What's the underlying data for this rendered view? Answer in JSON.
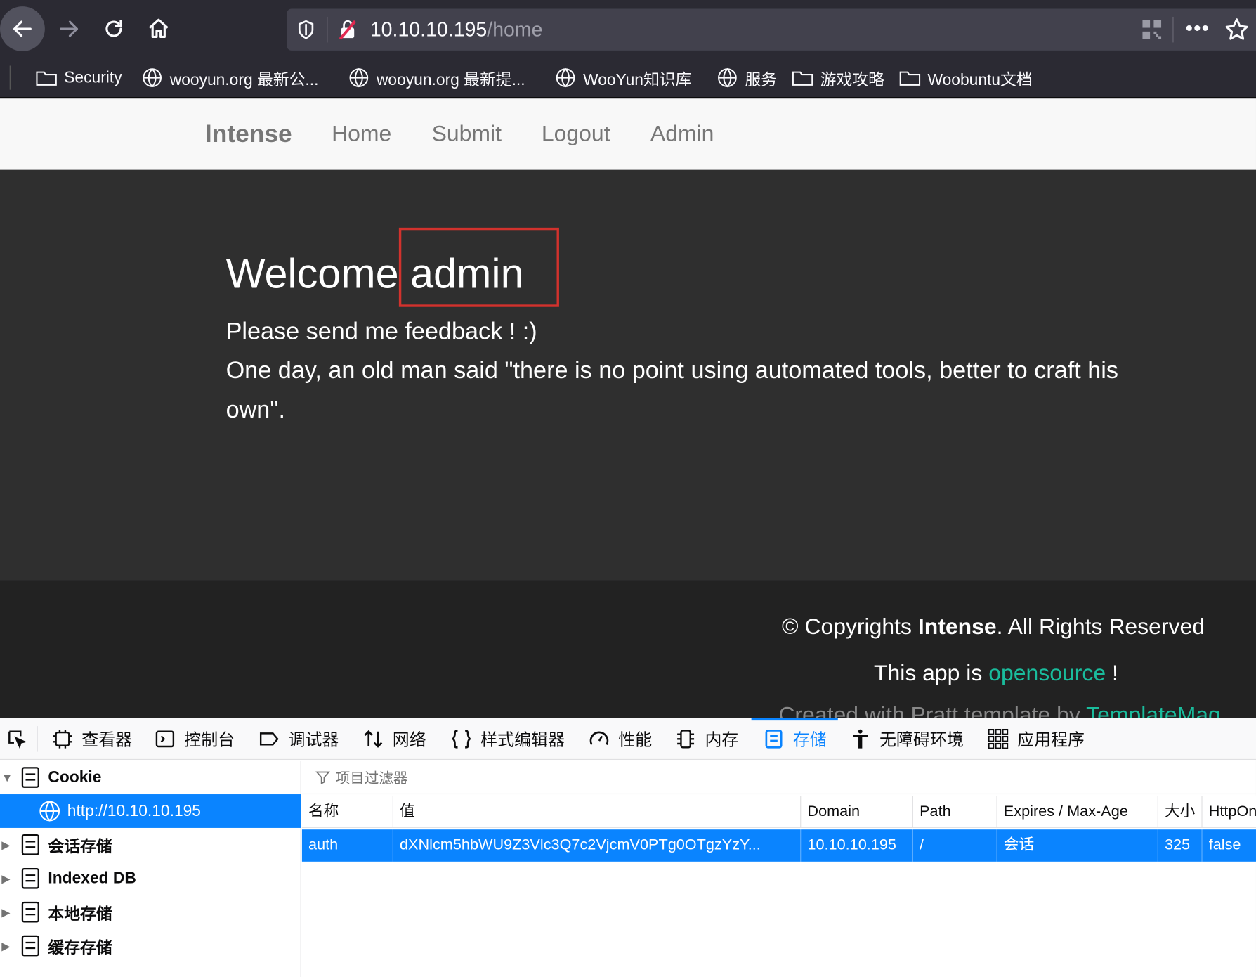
{
  "browser": {
    "url_host": "10.10.10.195",
    "url_path": "/home",
    "bookmarks": [
      {
        "label": "Security",
        "icon": "folder-icon"
      },
      {
        "label": "wooyun.org 最新公...",
        "icon": "globe-icon"
      },
      {
        "label": "wooyun.org 最新提...",
        "icon": "globe-icon"
      },
      {
        "label": "WooYun知识库",
        "icon": "globe-icon"
      },
      {
        "label": "服务",
        "icon": "globe-icon"
      },
      {
        "label": "游戏攻略",
        "icon": "folder-icon"
      },
      {
        "label": "Woobuntu文档",
        "icon": "folder-icon"
      }
    ]
  },
  "site": {
    "brand": "Intense",
    "nav": [
      "Home",
      "Submit",
      "Logout",
      "Admin"
    ],
    "welcome_prefix": "Welcome ",
    "welcome_user": "admin",
    "line1": "Please send me feedback ! :)",
    "line2": "One day, an old man said \"there is no point using automated tools, better to craft his own\".",
    "footer": {
      "copy_prefix": "© Copyrights ",
      "copy_brand": "Intense",
      "copy_suffix": ". All Rights Reserved",
      "app_prefix": "This app is ",
      "app_link": "opensource",
      "app_suffix": " !",
      "created_prefix": "Created with Pratt template by ",
      "created_link": "TemplateMag"
    }
  },
  "devtools": {
    "tabs": [
      "查看器",
      "控制台",
      "调试器",
      "网络",
      "样式编辑器",
      "性能",
      "内存",
      "存储",
      "无障碍环境",
      "应用程序"
    ],
    "active_tab": "存储",
    "tree": {
      "cookie": "Cookie",
      "cookie_host": "http://10.10.10.195",
      "session": "会话存储",
      "indexeddb": "Indexed DB",
      "local": "本地存储",
      "cache": "缓存存储"
    },
    "filter_placeholder": "项目过滤器",
    "columns": [
      "名称",
      "值",
      "Domain",
      "Path",
      "Expires / Max-Age",
      "大小",
      "HttpOnly"
    ],
    "row": [
      "auth",
      "dXNlcm5hbWU9Z3Vlc3Q7c2VjcmV0PTg0OTgzYzY...",
      "10.10.10.195",
      "/",
      "会话",
      "325",
      "false"
    ]
  },
  "colors": {
    "accent": "#0a84ff",
    "highlight_box": "#d2322d",
    "link_green": "#1abc9c"
  }
}
